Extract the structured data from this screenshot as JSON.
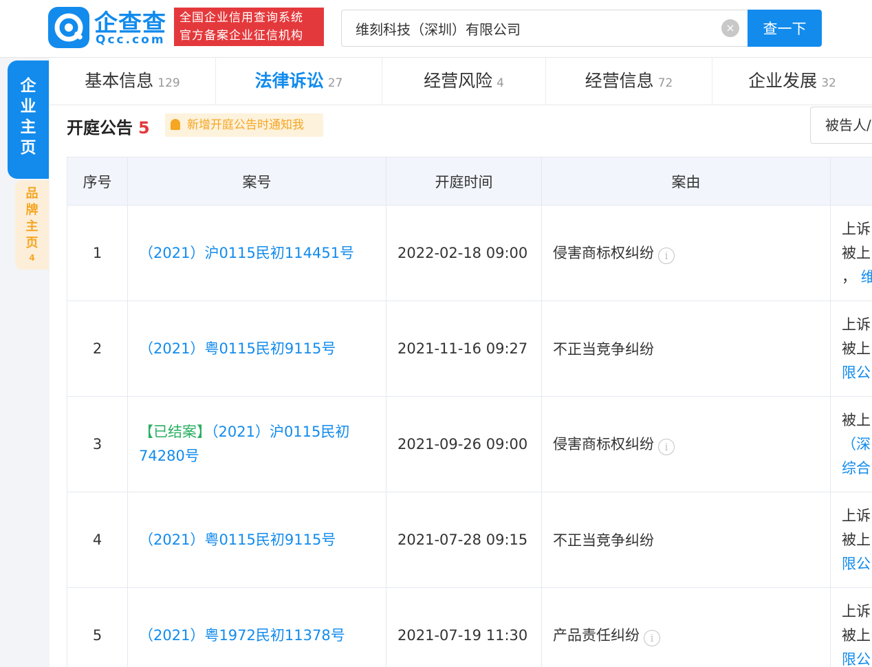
{
  "header": {
    "logo_cn": "企查查",
    "logo_en": "Qcc.com",
    "badge_line1": "全国企业信用查询系统",
    "badge_line2": "官方备案企业征信机构",
    "search_value": "维刻科技（深圳）有限公司",
    "clear_symbol": "×",
    "search_button": "查一下"
  },
  "sidebar": {
    "main": [
      "企",
      "业",
      "主",
      "页"
    ],
    "brand": [
      "品",
      "牌",
      "主",
      "页"
    ],
    "brand_count": "4"
  },
  "tabs": [
    {
      "label": "基本信息",
      "count": "129"
    },
    {
      "label": "法律诉讼",
      "count": "27"
    },
    {
      "label": "经营风险",
      "count": "4"
    },
    {
      "label": "经营信息",
      "count": "72"
    },
    {
      "label": "企业发展",
      "count": "32"
    }
  ],
  "section": {
    "title": "开庭公告",
    "count": "5",
    "notify": "新增开庭公告时通知我",
    "filter": "被告人/"
  },
  "table": {
    "headers": {
      "idx": "序号",
      "case": "案号",
      "date": "开庭时间",
      "reason": "案由"
    },
    "rows": [
      {
        "idx": "1",
        "tag": "",
        "case": "（2021）沪0115民初114451号",
        "date": "2022-02-18 09:00",
        "reason": "侵害商标权纠纷",
        "info": "i",
        "party1": "上诉",
        "party2": "被上",
        "party3a": "，",
        "party3b": "维"
      },
      {
        "idx": "2",
        "tag": "",
        "case": "（2021）粤0115民初9115号",
        "date": "2021-11-16 09:27",
        "reason": "不正当竞争纠纷",
        "info": "",
        "party1": "上诉",
        "party2": "被上",
        "party3a": "",
        "party3b": "限公"
      },
      {
        "idx": "3",
        "tag": "【已结案】",
        "case": "（2021）沪0115民初74280号",
        "date": "2021-09-26 09:00",
        "reason": "侵害商标权纠纷",
        "info": "i",
        "party1": "被上",
        "party2": "（深",
        "party3a": "",
        "party3b": "综合"
      },
      {
        "idx": "4",
        "tag": "",
        "case": "（2021）粤0115民初9115号",
        "date": "2021-07-28 09:15",
        "reason": "不正当竞争纠纷",
        "info": "",
        "party1": "上诉",
        "party2": "被上",
        "party3a": "",
        "party3b": "限公"
      },
      {
        "idx": "5",
        "tag": "",
        "case": "（2021）粤1972民初11378号",
        "date": "2021-07-19 11:30",
        "reason": "产品责任纠纷",
        "info": "i",
        "party1": "上诉",
        "party2": "被上",
        "party3a": "",
        "party3b": "限公"
      }
    ]
  },
  "colors": {
    "brand_blue": "#128bed",
    "badge_red": "#e4393c",
    "closed_green": "#27ae60",
    "notify_orange": "#f5a623"
  },
  "icons": [
    "logo-icon",
    "clear-icon",
    "bell-icon",
    "info-icon"
  ]
}
